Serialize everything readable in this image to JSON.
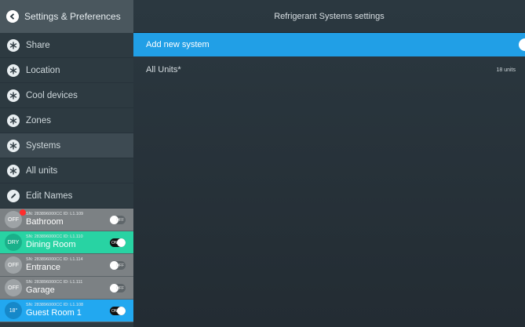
{
  "sidebar": {
    "header_title": "Settings & Preferences",
    "menu": [
      {
        "label": "Share",
        "icon": "snowflake-icon"
      },
      {
        "label": "Location",
        "icon": "snowflake-icon"
      },
      {
        "label": "Cool devices",
        "icon": "snowflake-icon"
      },
      {
        "label": "Zones",
        "icon": "snowflake-icon"
      },
      {
        "label": "Systems",
        "icon": "snowflake-icon",
        "active": true
      },
      {
        "label": "All units",
        "icon": "snowflake-icon"
      },
      {
        "label": "Edit Names",
        "icon": "pencil-icon"
      }
    ],
    "rooms": [
      {
        "mode": "OFF",
        "serial": "SN: 283896000CC ID: L1.109",
        "name": "Bathroom",
        "toggle": "OFF",
        "alert": true
      },
      {
        "mode": "DRY",
        "serial": "SN: 283896000CC ID: L1.110",
        "name": "Dining Room",
        "toggle": "ON"
      },
      {
        "mode": "OFF",
        "serial": "SN: 283896000CC ID: L1.114",
        "name": "Entrance",
        "toggle": "OFF"
      },
      {
        "mode": "OFF",
        "serial": "SN: 283896000CC ID: L1.111",
        "name": "Garage",
        "toggle": "OFF"
      },
      {
        "mode": "18°",
        "serial": "SN: 283896000CC ID: L1.108",
        "name": "Guest Room 1",
        "toggle": "ON"
      }
    ]
  },
  "main": {
    "title": "Refrigerant Systems settings",
    "add_label": "Add new system",
    "rows": [
      {
        "label": "All Units*",
        "count": "18 units"
      }
    ]
  },
  "colors": {
    "accent_blue": "#219fe6",
    "dry_green": "#28d3a3",
    "off_gray": "#7c8184",
    "alert_red": "#ff2d2d"
  }
}
